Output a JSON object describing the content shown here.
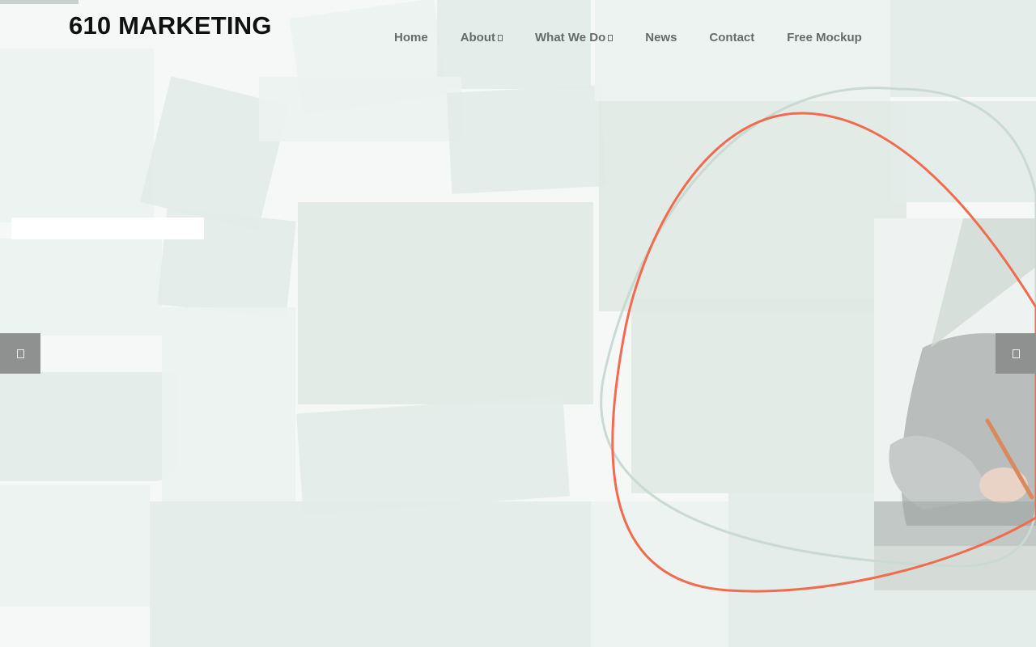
{
  "header": {
    "logo_text": "610 MARKETING",
    "nav": [
      {
        "label": "Home",
        "has_dropdown": false
      },
      {
        "label": "About",
        "has_dropdown": true
      },
      {
        "label": "What We Do",
        "has_dropdown": true
      },
      {
        "label": "News",
        "has_dropdown": false
      },
      {
        "label": "Contact",
        "has_dropdown": false
      },
      {
        "label": "Free Mockup",
        "has_dropdown": false
      }
    ]
  },
  "slider": {
    "prev_icon": "chevron-left-icon",
    "next_icon": "chevron-right-icon"
  },
  "colors": {
    "accent_orange": "#f26b4e",
    "accent_sage": "#c8dad2",
    "nav_text": "#666b69",
    "logo_text": "#111111",
    "slider_button": "#8e918f"
  }
}
